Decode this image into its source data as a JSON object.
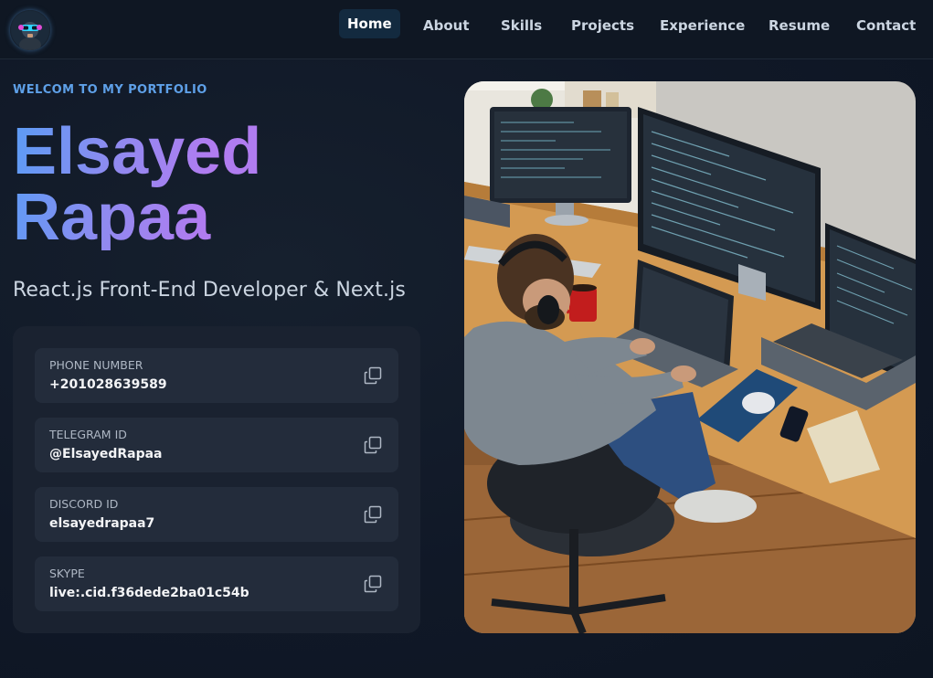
{
  "nav": {
    "logo_icon": "astronaut-avatar-icon",
    "items": [
      {
        "label": "Home",
        "active": true
      },
      {
        "label": "About",
        "active": false
      },
      {
        "label": "Skills",
        "active": false
      },
      {
        "label": "Projects",
        "active": false
      },
      {
        "label": "Experience",
        "active": false
      },
      {
        "label": "Resume",
        "active": false
      },
      {
        "label": "Contact",
        "active": false
      }
    ]
  },
  "hero": {
    "eyebrow": "WELCOM TO MY PORTFOLIO",
    "name_line1": "Elsayed",
    "name_line2": "Rapaa",
    "role": "React.js Front-End Developer & Next.js",
    "image_icon": "developer-workspace-illustration"
  },
  "contacts": [
    {
      "label": "PHONE NUMBER",
      "value": "+201028639589",
      "icon": "copy-icon"
    },
    {
      "label": "TELEGRAM ID",
      "value": "@ElsayedRapaa",
      "icon": "copy-icon"
    },
    {
      "label": "DISCORD ID",
      "value": "elsayedrapaa7",
      "icon": "copy-icon"
    },
    {
      "label": "SKYPE",
      "value": "live:.cid.f36dede2ba01c54b",
      "icon": "copy-icon"
    }
  ],
  "colors": {
    "accent": "#5ea0e8",
    "gradient_start": "#5b9cf5",
    "gradient_end": "#b07cf0",
    "background": "#101827",
    "card": "#1a2230",
    "card_item": "#232c3b"
  }
}
